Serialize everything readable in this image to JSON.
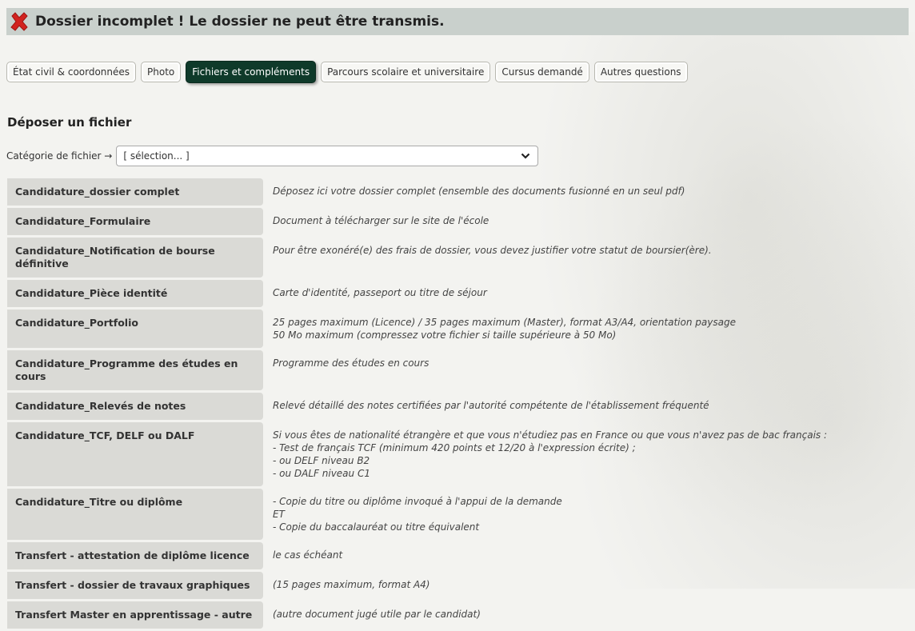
{
  "banner": {
    "icon": "x-icon",
    "icon_color": "#d2231f",
    "title": "Dossier incomplet ! Le dossier ne peut être transmis."
  },
  "tabs": [
    {
      "label": "État civil & coordonnées",
      "active": false
    },
    {
      "label": "Photo",
      "active": false
    },
    {
      "label": "Fichiers et compléments",
      "active": true
    },
    {
      "label": "Parcours scolaire et universitaire",
      "active": false
    },
    {
      "label": "Cursus demandé",
      "active": false
    },
    {
      "label": "Autres questions",
      "active": false
    }
  ],
  "upload": {
    "section_title": "Déposer un fichier",
    "category_label": "Catégorie de fichier →",
    "category_value": "[ sélection... ]"
  },
  "files": [
    {
      "name": "Candidature_dossier complet",
      "desc": "Déposez ici votre dossier complet (ensemble des documents fusionné en un seul pdf)"
    },
    {
      "name": "Candidature_Formulaire",
      "desc": "Document à télécharger sur le site de l'école"
    },
    {
      "name": "Candidature_Notification de bourse définitive",
      "desc": "Pour être exonéré(e) des frais de dossier, vous devez justifier votre statut de boursier(ère)."
    },
    {
      "name": "Candidature_Pièce identité",
      "desc": "Carte d'identité, passeport ou titre de séjour"
    },
    {
      "name": "Candidature_Portfolio",
      "desc": "25 pages maximum (Licence) / 35 pages maximum (Master), format A3/A4, orientation paysage\n50 Mo maximum (compressez votre fichier si taille supérieure à 50 Mo)"
    },
    {
      "name": "Candidature_Programme des études en cours",
      "desc": "Programme des études en cours"
    },
    {
      "name": "Candidature_Relevés de notes",
      "desc": "Relevé détaillé des notes certifiées par l'autorité compétente de l'établissement fréquenté"
    },
    {
      "name": "Candidature_TCF, DELF ou DALF",
      "desc": "Si vous êtes de nationalité étrangère et que vous n'étudiez pas en France ou que vous n'avez pas de bac français :\n- Test de français TCF (minimum 420 points et 12/20 à l'expression écrite) ;\n- ou DELF niveau B2\n- ou DALF niveau C1"
    },
    {
      "name": "Candidature_Titre ou diplôme",
      "desc": "- Copie du titre ou diplôme invoqué à l'appui de la demande\nET\n- Copie du baccalauréat ou titre équivalent"
    },
    {
      "name": "Transfert - attestation de diplôme licence",
      "desc": "le cas échéant"
    },
    {
      "name": "Transfert - dossier de travaux graphiques",
      "desc": "(15 pages maximum, format A4)"
    },
    {
      "name": "Transfert Master en apprentissage - autre",
      "desc": "(autre document jugé utile par le candidat)"
    }
  ]
}
